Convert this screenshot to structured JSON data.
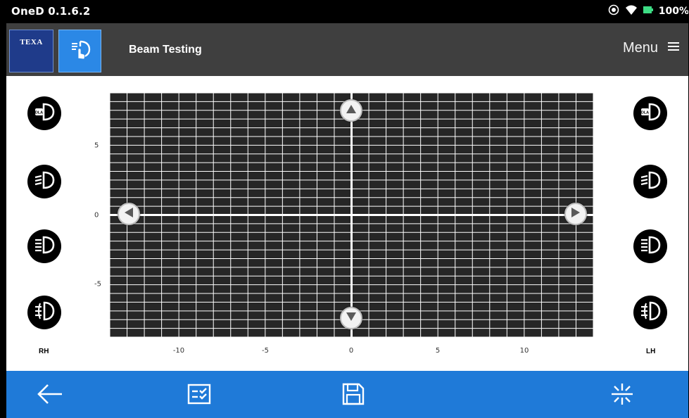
{
  "status_bar": {
    "app_version": "OneD 0.1.6.2",
    "battery_percent": "100%",
    "icons": [
      "record-icon",
      "wifi-icon",
      "battery-icon"
    ]
  },
  "header": {
    "logo_text": "TEXA",
    "module_icon": "headlight-touch-icon",
    "title": "Beam Testing",
    "menu_label": "Menu",
    "menu_icon": "hamburger-icon"
  },
  "left_panel": {
    "side_label": "RH",
    "lamps": [
      {
        "type": "dla",
        "icon": "dla-headlight-icon",
        "badge": "DLA"
      },
      {
        "type": "low-beam",
        "icon": "low-beam-icon"
      },
      {
        "type": "high-beam",
        "icon": "high-beam-icon"
      },
      {
        "type": "fog",
        "icon": "fog-light-icon"
      }
    ]
  },
  "right_panel": {
    "side_label": "LH",
    "lamps": [
      {
        "type": "dla",
        "icon": "dla-headlight-icon",
        "badge": "DLA"
      },
      {
        "type": "low-beam",
        "icon": "low-beam-icon"
      },
      {
        "type": "high-beam",
        "icon": "high-beam-icon"
      },
      {
        "type": "fog",
        "icon": "fog-light-icon"
      }
    ]
  },
  "grid": {
    "x_ticks": [
      "-10",
      "-5",
      "0",
      "5",
      "10"
    ],
    "y_ticks": [
      "5",
      "0",
      "-5"
    ],
    "x_range": [
      -14,
      14
    ],
    "y_range": [
      -7,
      7
    ],
    "colors": {
      "background": "#262626",
      "grid_lines": "#ffffff",
      "axes": "#ffffff"
    }
  },
  "bottom_bar": {
    "buttons": [
      {
        "name": "back-button",
        "icon": "arrow-left-icon"
      },
      {
        "name": "checklist-button",
        "icon": "checklist-icon"
      },
      {
        "name": "save-button",
        "icon": "floppy-disk-icon"
      },
      {
        "name": "lamp-settings-button",
        "icon": "light-burst-icon"
      }
    ]
  },
  "colors": {
    "header_bg": "#3f3f3f",
    "accent_blue": "#1f7ad8",
    "texa_blue": "#1f3b8a",
    "lamp_bg": "#000000"
  }
}
